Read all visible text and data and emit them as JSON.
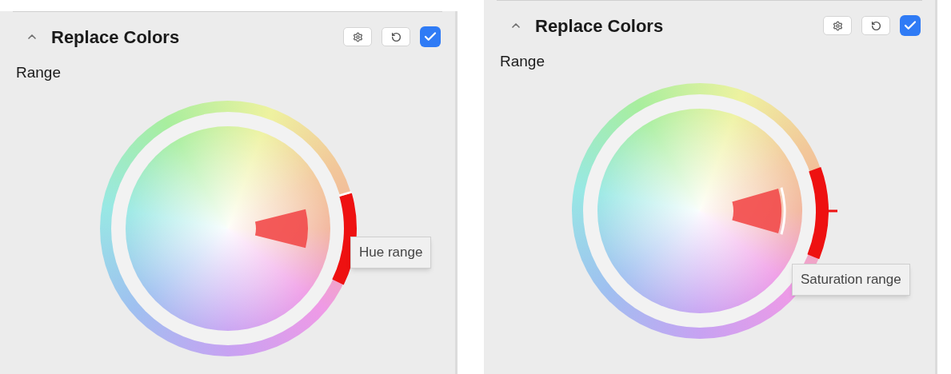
{
  "panels": [
    {
      "title": "Replace Colors",
      "expanded": true,
      "enabled": true,
      "label": "Range",
      "tooltip": {
        "kind": "hue",
        "text": "Hue range"
      }
    },
    {
      "title": "Replace Colors",
      "expanded": true,
      "enabled": true,
      "label": "Range",
      "tooltip": {
        "kind": "saturation",
        "text": "Saturation range"
      }
    }
  ]
}
